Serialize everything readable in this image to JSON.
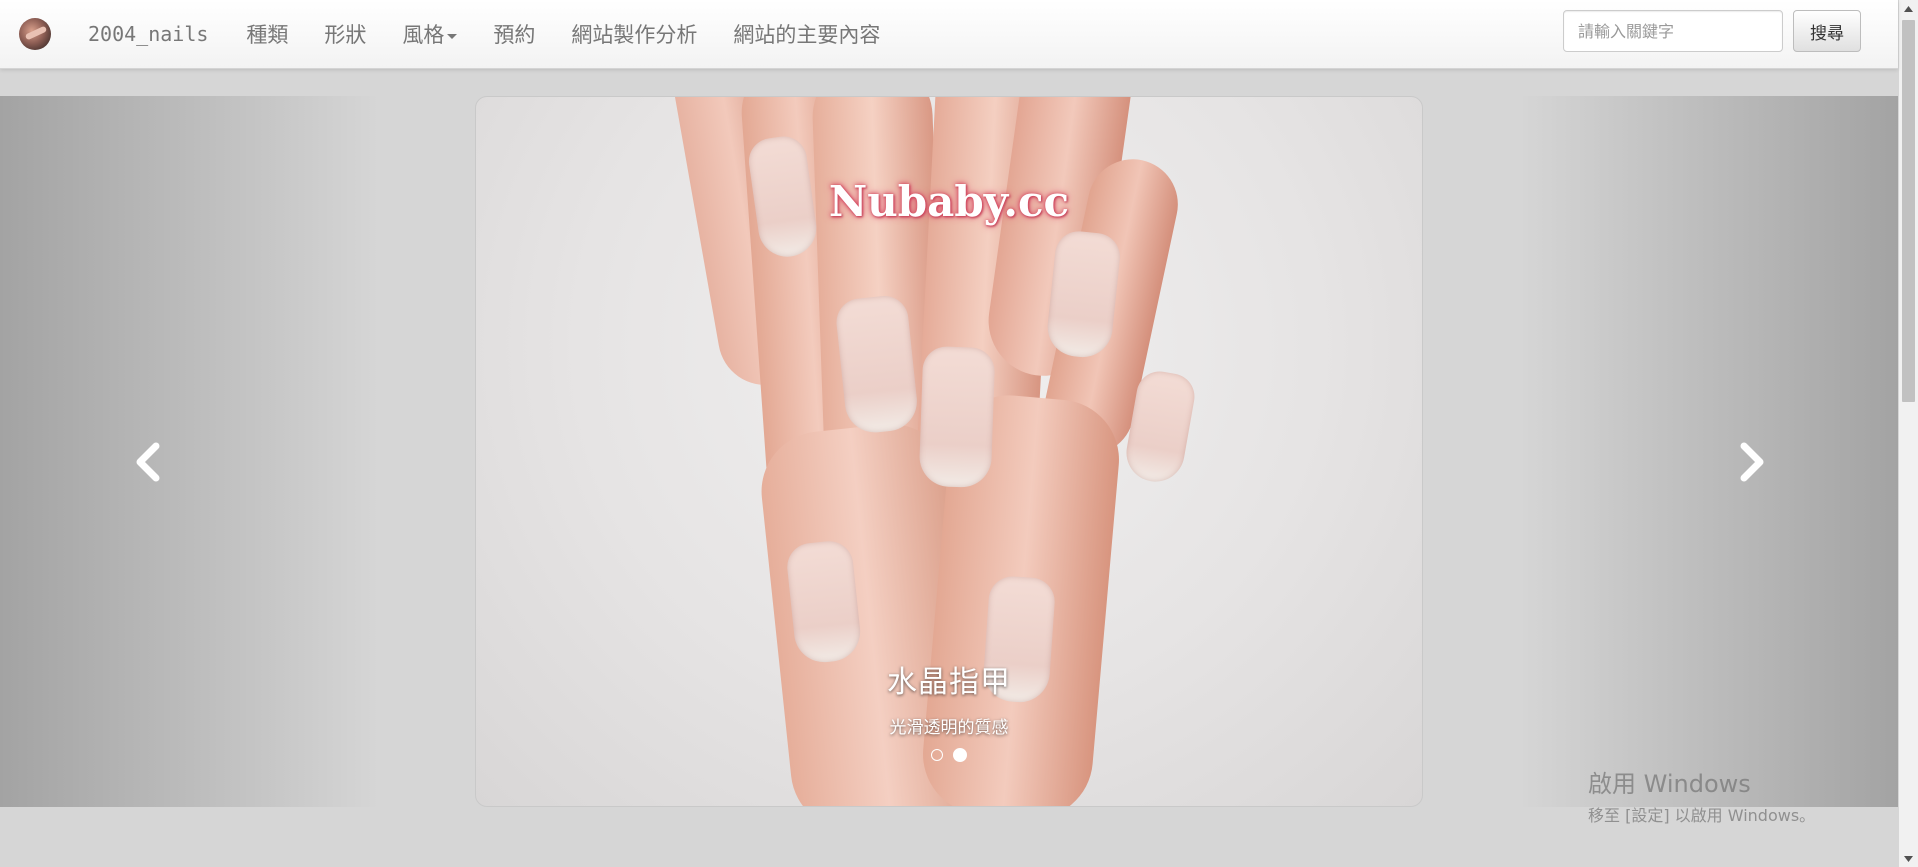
{
  "navbar": {
    "brand": "2004_nails",
    "items": [
      {
        "label": "種類"
      },
      {
        "label": "形狀"
      },
      {
        "label": "風格",
        "dropdown": true
      },
      {
        "label": "預約"
      },
      {
        "label": "網站製作分析"
      },
      {
        "label": "網站的主要內容"
      }
    ],
    "search_placeholder": "請輸入關鍵字",
    "search_button": "搜尋"
  },
  "carousel": {
    "watermark": "Nubaby.cc",
    "caption_title": "水晶指甲",
    "caption_subtitle": "光滑透明的質感",
    "slide_count": 2,
    "active_slide": 2,
    "prev_icon": "chevron-left-icon",
    "next_icon": "chevron-right-icon"
  },
  "activation": {
    "title": "啟用 Windows",
    "subtitle": "移至 [設定] 以啟用 Windows。"
  },
  "colors": {
    "page_background": "#d6d6d6",
    "navbar_background": "#f8f8f8",
    "nav_text": "#777777",
    "watermark_glow": "#d4455a"
  }
}
